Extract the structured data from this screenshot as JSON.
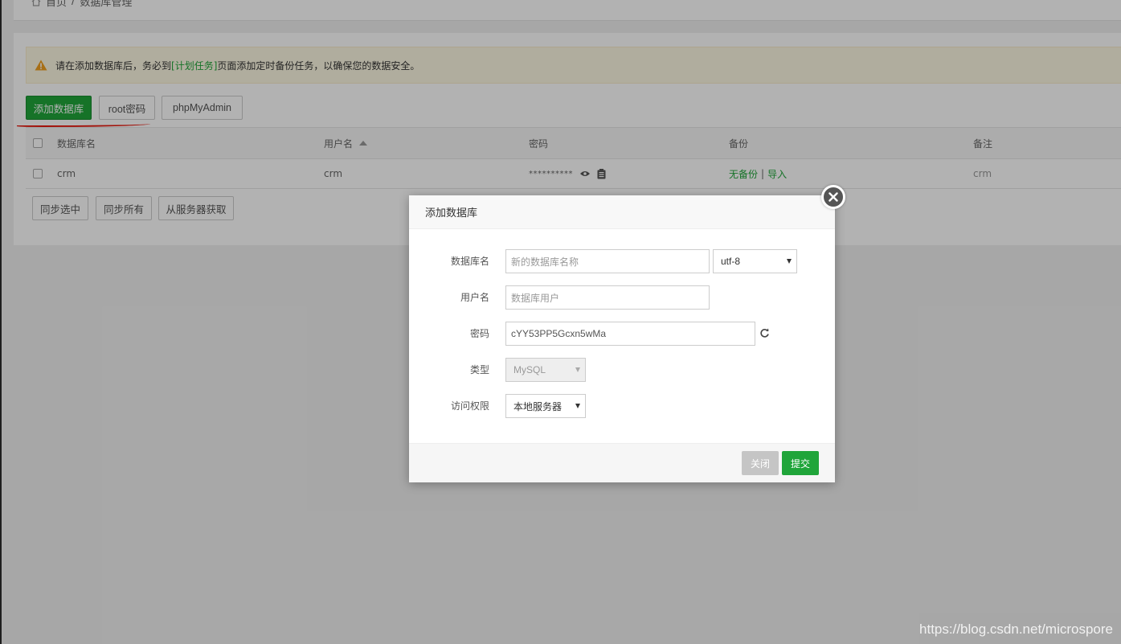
{
  "breadcrumb": {
    "home": "首页",
    "separator": "/",
    "current": "数据库管理"
  },
  "alert": {
    "prefix": "请在添加数据库后，务必到",
    "link": "[计划任务]",
    "suffix": "页面添加定时备份任务，以确保您的数据安全。"
  },
  "toolbar": {
    "add_db": "添加数据库",
    "root_pwd": "root密码",
    "phpmyadmin": "phpMyAdmin"
  },
  "table": {
    "headers": {
      "name": "数据库名",
      "user": "用户名",
      "password": "密码",
      "backup": "备份",
      "note": "备注"
    },
    "rows": [
      {
        "name": "crm",
        "user": "crm",
        "password": "**********",
        "backup_none": "无备份",
        "backup_sep": "|",
        "backup_import": "导入",
        "note": "crm"
      }
    ]
  },
  "bottom_buttons": {
    "sync_selected": "同步选中",
    "sync_all": "同步所有",
    "get_from_server": "从服务器获取"
  },
  "modal": {
    "title": "添加数据库",
    "fields": {
      "db_name": {
        "label": "数据库名",
        "placeholder": "新的数据库名称",
        "charset": "utf-8"
      },
      "username": {
        "label": "用户名",
        "placeholder": "数据库用户"
      },
      "password": {
        "label": "密码",
        "value": "cYY53PP5Gcxn5wMa"
      },
      "type": {
        "label": "类型",
        "value": "MySQL"
      },
      "access": {
        "label": "访问权限",
        "value": "本地服务器"
      }
    },
    "close_label": "关闭",
    "submit_label": "提交"
  },
  "watermark": "https://blog.csdn.net/microspore"
}
